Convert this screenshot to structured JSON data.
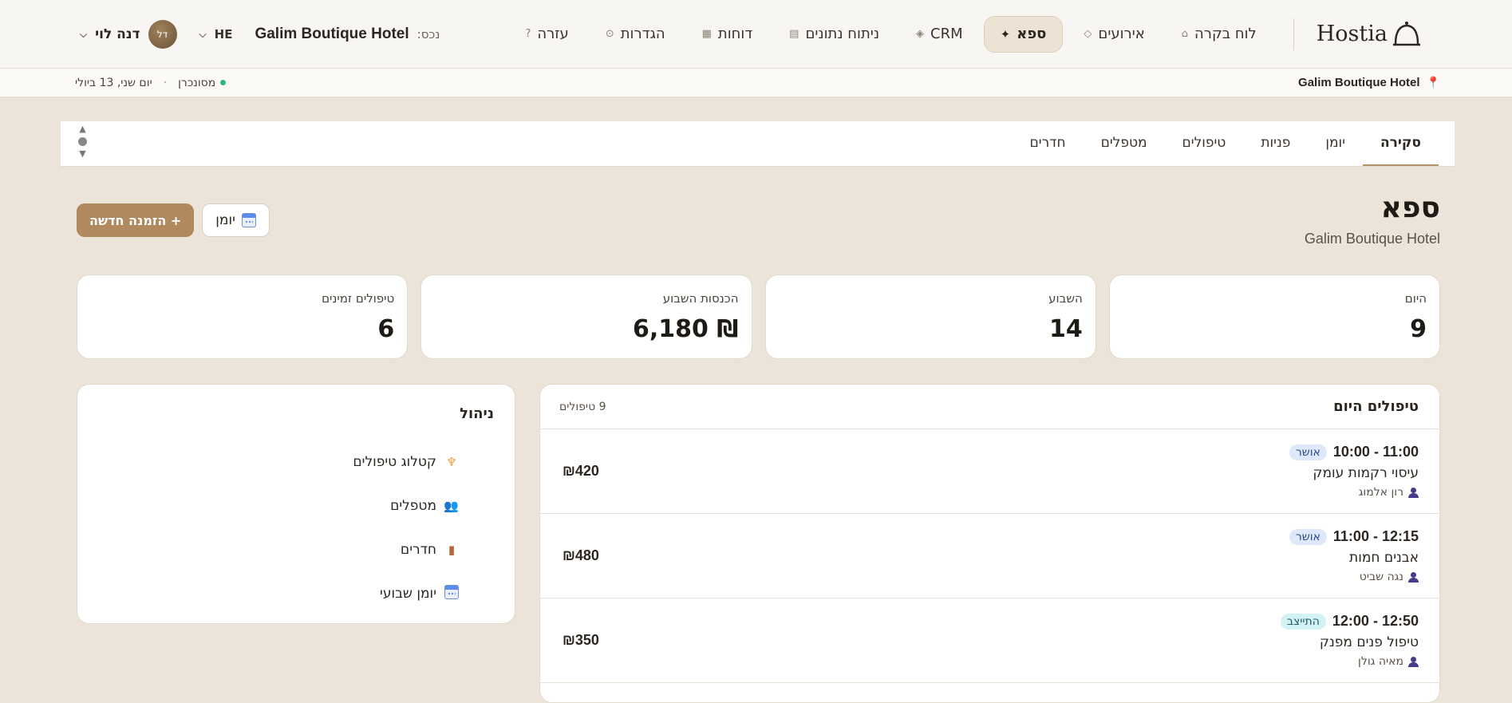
{
  "nav": {
    "brand": "Hostia",
    "items": [
      {
        "id": "front-desk",
        "label": "לוח בקרה",
        "icon": "⌂",
        "active": false
      },
      {
        "id": "events",
        "label": "אירועים",
        "icon": "◇",
        "active": false
      },
      {
        "id": "spa",
        "label": "ספא",
        "icon": "✦",
        "active": true
      },
      {
        "id": "crm",
        "label": "CRM",
        "icon": "◈",
        "active": false
      },
      {
        "id": "analytics",
        "label": "ניתוח נתונים",
        "icon": "▤",
        "active": false
      },
      {
        "id": "reports",
        "label": "דוחות",
        "icon": "▦",
        "active": false
      },
      {
        "id": "settings",
        "label": "הגדרות",
        "icon": "⊙",
        "active": false
      },
      {
        "id": "help",
        "label": "עזרה",
        "icon": "?",
        "active": false
      }
    ],
    "property_label": "נכס:",
    "property_name": "Galim Boutique Hotel",
    "language": "HE",
    "user_name": "דנה לוי",
    "user_initials": "דל"
  },
  "subbar": {
    "property": "Galim Boutique Hotel",
    "sync_status": "מסונכרן",
    "date": "יום שני, 13 ביולי"
  },
  "tabs": [
    {
      "label": "סקירה",
      "active": true
    },
    {
      "label": "יומן",
      "active": false
    },
    {
      "label": "פניות",
      "active": false
    },
    {
      "label": "טיפולים",
      "active": false
    },
    {
      "label": "מטפלים",
      "active": false
    },
    {
      "label": "חדרים",
      "active": false
    }
  ],
  "page": {
    "title": "ספא",
    "subtitle": "Galim Boutique Hotel",
    "calendar_button": "יומן",
    "new_booking_button": "+ הזמנה חדשה"
  },
  "stats": [
    {
      "label": "היום",
      "value": "9"
    },
    {
      "label": "השבוע",
      "value": "14"
    },
    {
      "label": "הכנסות השבוע",
      "value": "₪ 6,180"
    },
    {
      "label": "טיפולים זמינים",
      "value": "6"
    }
  ],
  "today": {
    "title": "טיפולים היום",
    "count": "9 טיפולים",
    "rows": [
      {
        "time": "11:00 - 10:00",
        "status": "אושר",
        "status_type": "ok",
        "treatment": "עיסוי רקמות עומק",
        "therapist": "רון אלמוג",
        "price": "₪420"
      },
      {
        "time": "12:15 - 11:00",
        "status": "אושר",
        "status_type": "ok",
        "treatment": "אבנים חמות",
        "therapist": "נגה שביט",
        "price": "₪480"
      },
      {
        "time": "12:50 - 12:00",
        "status": "התייצב",
        "status_type": "in",
        "treatment": "טיפול פנים מפנק",
        "therapist": "מאיה גולן",
        "price": "₪350"
      }
    ]
  },
  "management": {
    "title": "ניהול",
    "items": [
      {
        "label": "קטלוג טיפולים",
        "icon": "massage-icon"
      },
      {
        "label": "מטפלים",
        "icon": "people-icon"
      },
      {
        "label": "חדרים",
        "icon": "door-icon"
      },
      {
        "label": "יומן שבועי",
        "icon": "calendar-icon"
      }
    ]
  },
  "colors": {
    "accent": "#b08a5e",
    "background": "#ece4d9",
    "status_confirmed": "#dde9fb",
    "status_checked_in": "#d3f2f5"
  }
}
